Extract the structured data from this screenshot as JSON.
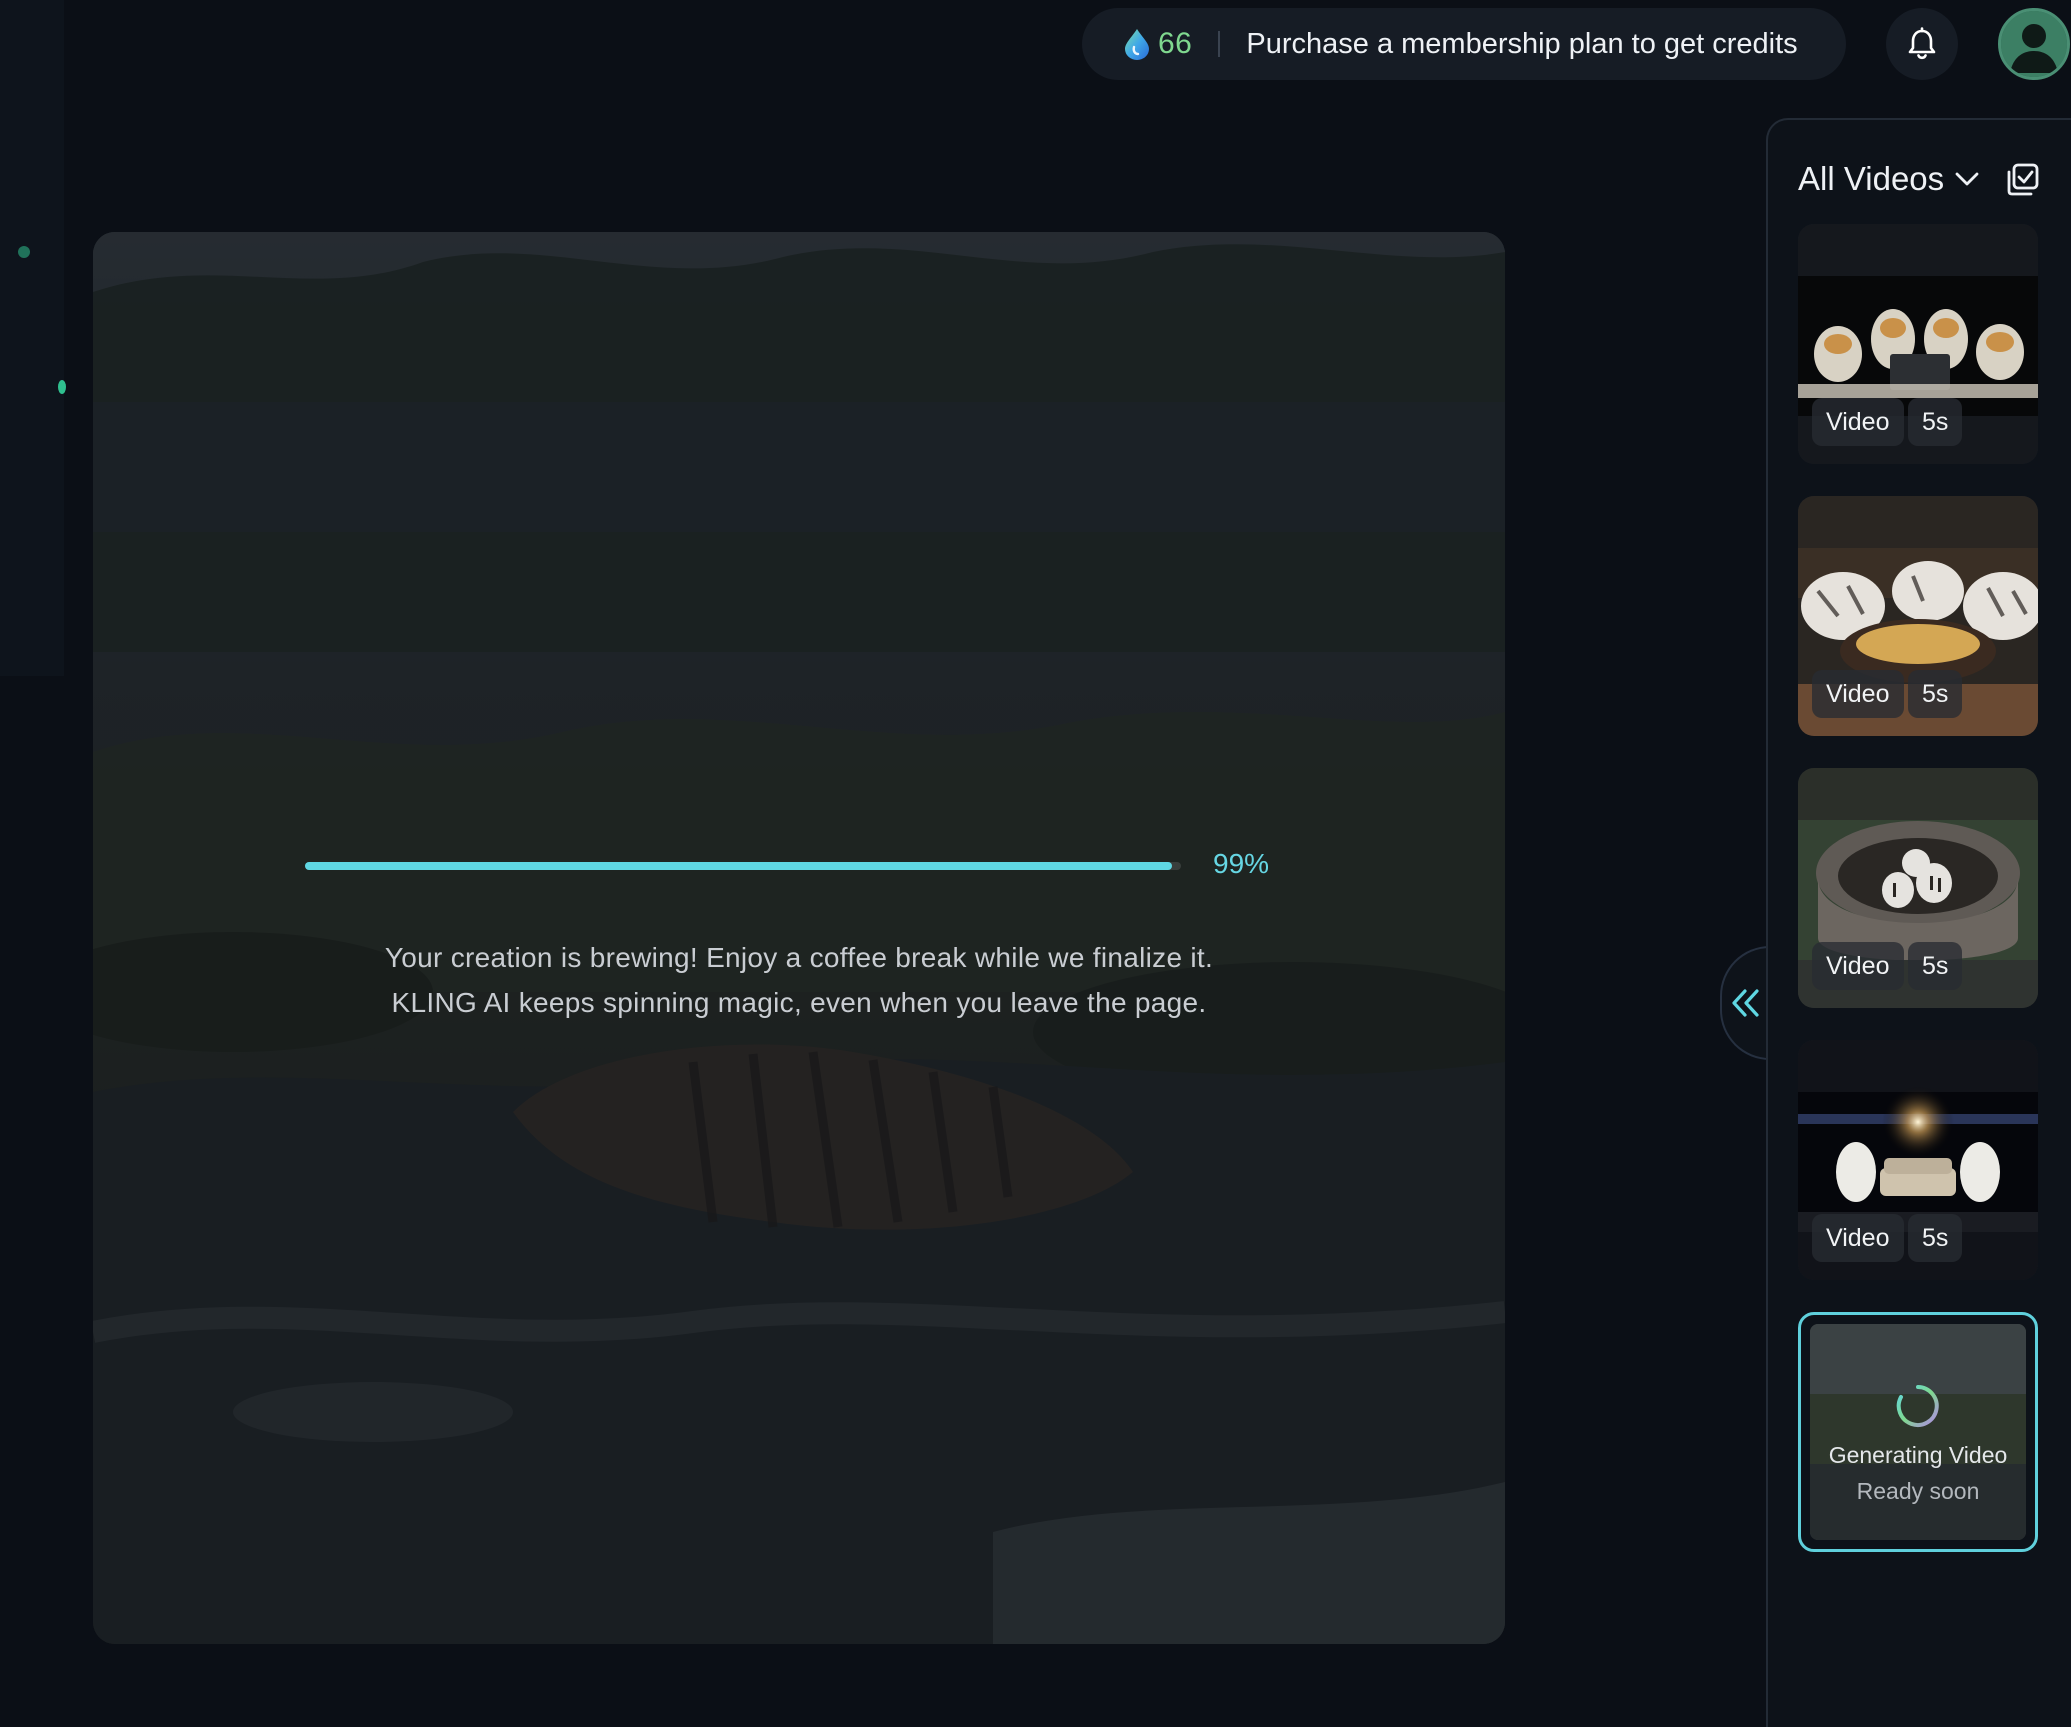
{
  "header": {
    "credits": "66",
    "purchase_text": "Purchase a membership plan to get credits",
    "icons": [
      "credit-drop-icon",
      "bell-icon",
      "avatar-icon"
    ]
  },
  "preview": {
    "progress_percent": 99,
    "progress_label": "99%",
    "message_line1": "Your creation is brewing! Enjoy a coffee break while we finalize it.",
    "message_line2": "KLING AI keeps spinning magic, even when you leave the page."
  },
  "panel": {
    "title": "All Videos",
    "icons": [
      "chevron-down-icon",
      "multi-select-icon",
      "collapse-double-chevron-icon"
    ],
    "items": [
      {
        "type": "Video",
        "duration": "5s"
      },
      {
        "type": "Video",
        "duration": "5s"
      },
      {
        "type": "Video",
        "duration": "5s"
      },
      {
        "type": "Video",
        "duration": "5s"
      }
    ],
    "generating": {
      "title": "Generating Video",
      "subtitle": "Ready soon"
    }
  },
  "colors": {
    "accent": "#5fd7e3",
    "credits": "#7fd88f",
    "background": "#0b0f16"
  }
}
